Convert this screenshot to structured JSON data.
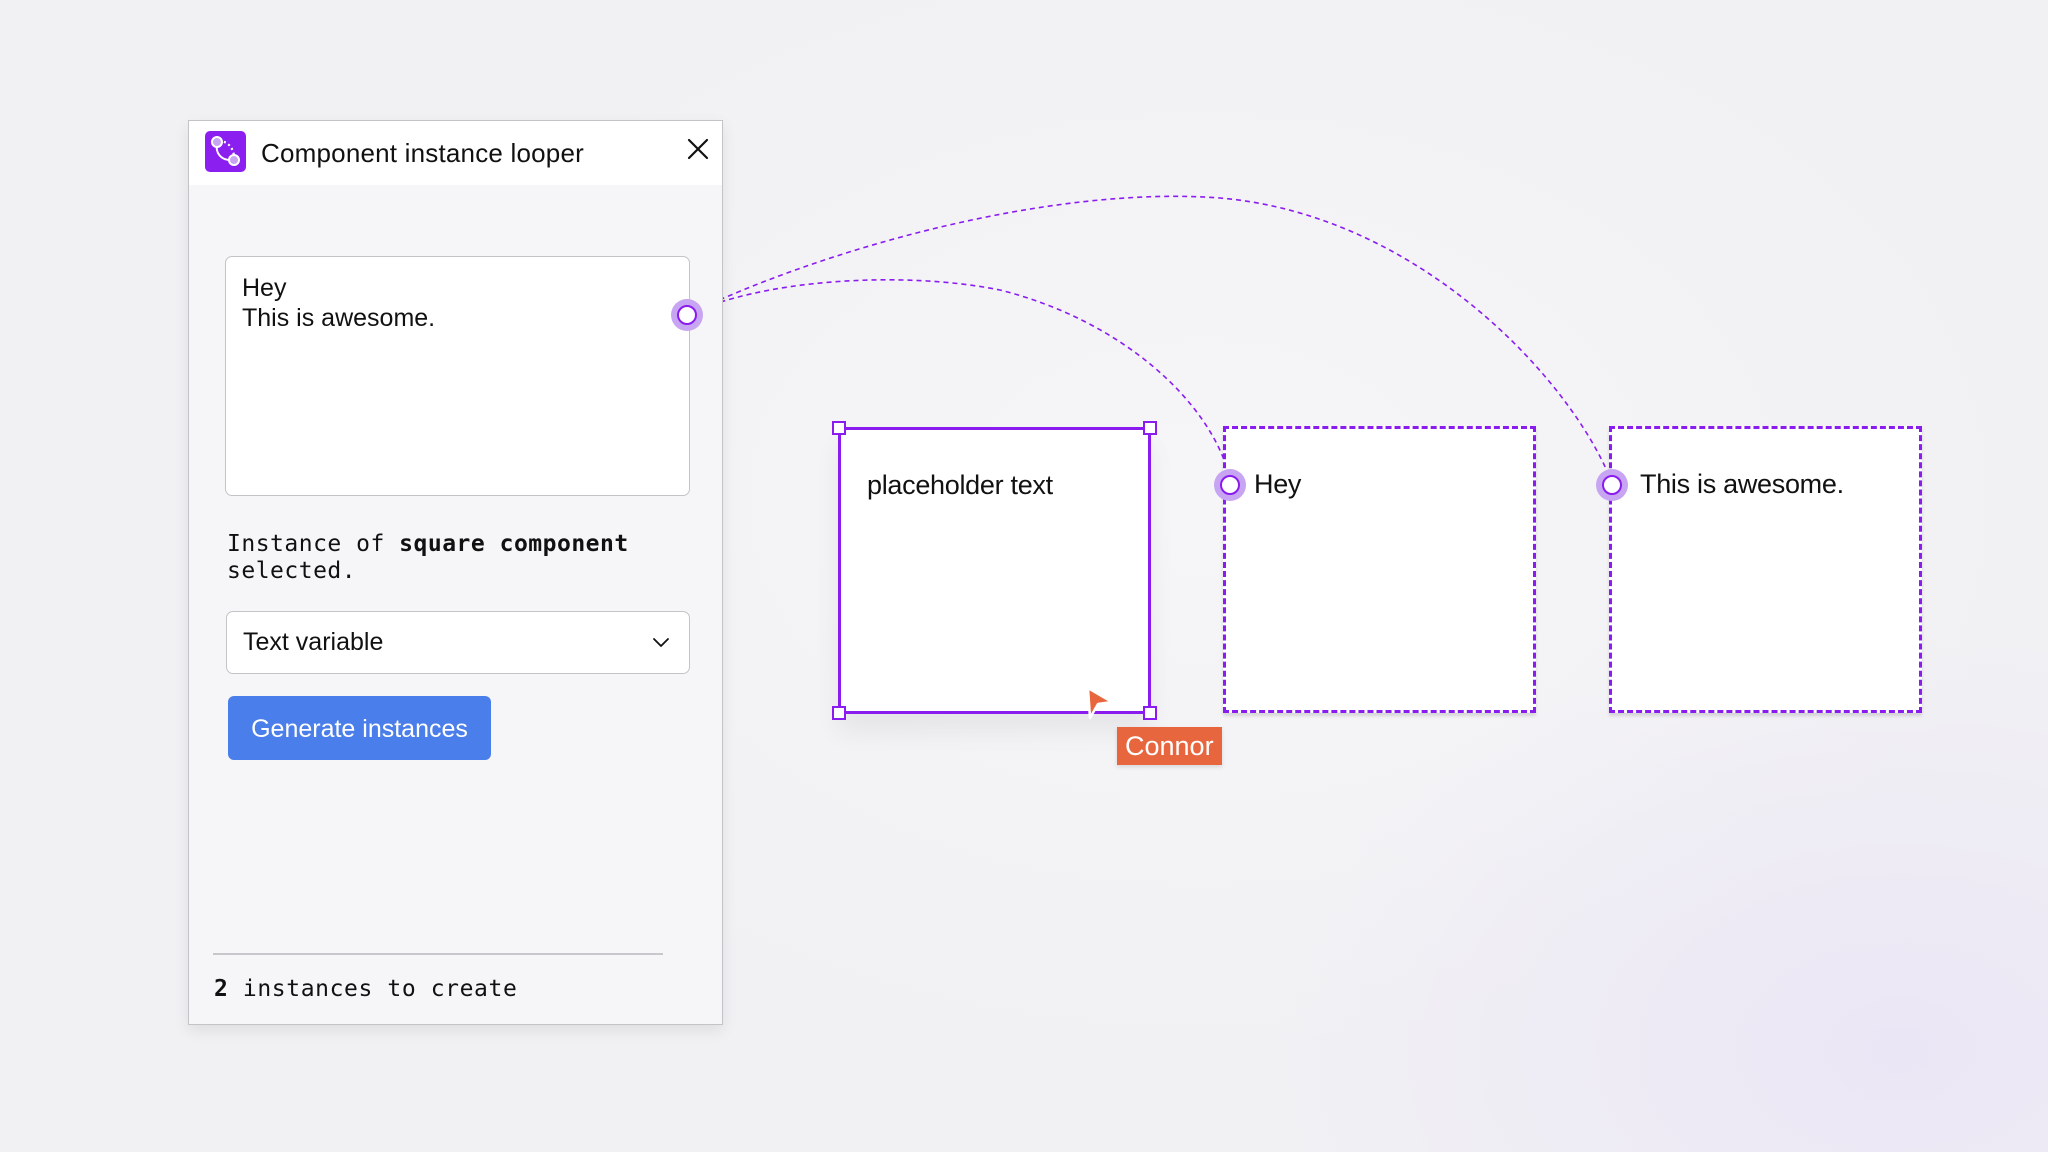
{
  "plugin": {
    "title": "Component instance looper",
    "icon": "plugin-loop-icon",
    "close_icon": "close-icon",
    "textarea_value": "Hey\nThis is awesome.",
    "info": {
      "prefix": "Instance of ",
      "component": "square component",
      "suffix": "selected."
    },
    "select": {
      "value": "Text variable",
      "icon": "chevron-down-icon"
    },
    "generate_button": "Generate instances",
    "footer": {
      "count": "2",
      "text": " instances to create"
    }
  },
  "canvas": {
    "source_square": {
      "text": "placeholder text",
      "state": "selected"
    },
    "instances": [
      {
        "text": "Hey"
      },
      {
        "text": "This is awesome."
      }
    ],
    "collaborator": {
      "name": "Connor",
      "color": "#e8663d"
    }
  },
  "colors": {
    "accent_purple": "#8a1cf0",
    "connector_ring": "#c7a5f3",
    "button_blue": "#4a7eea"
  }
}
